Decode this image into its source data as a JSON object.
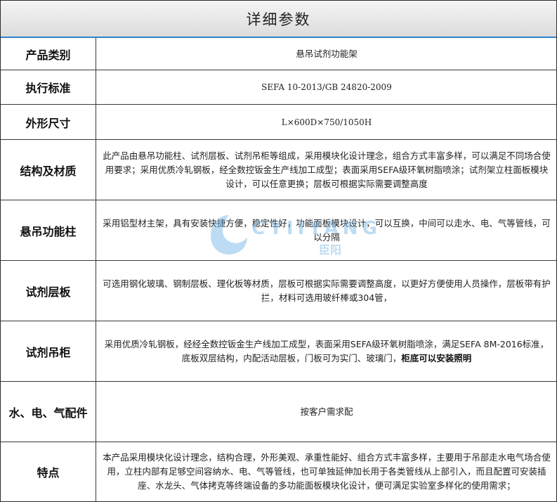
{
  "title": "详细参数",
  "rows": [
    {
      "label": "产品类别",
      "value": "悬吊试剂功能架"
    },
    {
      "label": "执行标准",
      "value": "SEFA 10-2013/GB 24820-2009"
    },
    {
      "label": "外形尺寸",
      "value": "L×600D×750/1050H"
    },
    {
      "label": "结构及材质",
      "value": "此产品由悬吊功能柱、试剂层板、试剂吊柜等组成，采用模块化设计理念，组合方式丰富多样，可以满足不同场合使用要求；采用优质冷轧钢板，经全数控钣金生产线加工成型；表面采用SEFA级环氧树脂喷涂；试剂架立柱面板模块设计，可以任意更换；层板可根据实际需要调整高度"
    },
    {
      "label": "悬吊功能柱",
      "value": "采用铝型材主架，具有安装快捷方便，稳定性好，功能面板模块设计，可以互换，中间可以走水、电、气等管线，可以分隔"
    },
    {
      "label": "试剂层板",
      "value": "可选用钢化玻璃、钢制层板、理化板等材质，层板可根据实际需要调整高度，以更好方便使用人员操作，层板带有护拦，材料可选用玻纤棒或304管，"
    },
    {
      "label": "试剂吊柜",
      "value": "采用优质冷轧钢板，经经全数控钣金生产线加工成型，表面采用SEFA级环氧树脂喷涂，满足SEFA 8M-2016标准，底板双层结构，内配活动层板，门板可为实门、玻璃门，",
      "value_bold": "柜底可以安装照明"
    },
    {
      "label": "水、电、气配件",
      "value": "按客户需求配"
    },
    {
      "label": "特点",
      "value": "本产品采用模块化设计理念，结构合理，外形美观、承重性能好、组合方式丰富多样，主要用于吊部走水电气场合使用，立柱内部有足够空间容纳水、电、气等管线，也可单独延伸加长用于各类管线从上部引入，而且配置可安装插座、水龙头、气体拷克等终端设备的多功能面板模块化设计，便可满足实验室多样化的使用需求；"
    }
  ],
  "watermark": {
    "text": "CYIIYANG",
    "subtext": "臣阳"
  },
  "colors": {
    "header_underline": "#2f82c9",
    "watermark": "#6fb3e6",
    "border": "#3a3a3a"
  }
}
